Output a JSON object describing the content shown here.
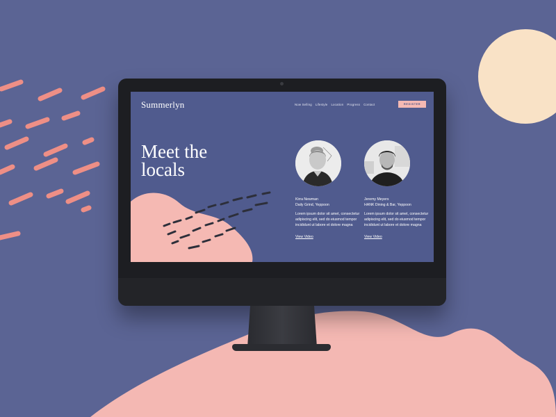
{
  "site": {
    "logo": "Summerlyn",
    "nav": [
      "Now Selling",
      "Lifestyle",
      "Location",
      "Progress",
      "Contact"
    ],
    "register_label": "REGISTER"
  },
  "hero": {
    "title_line1": "Meet the",
    "title_line2": "locals"
  },
  "profiles": [
    {
      "name": "Kirra Newman",
      "business": "Daily Grind,  Yeppoon",
      "desc": "Lorem ipsum dolor sit amet, consectetur adipiscing elit, sed do eiusmod tempor incididunt ut labore et dolore magna",
      "link": "View Video"
    },
    {
      "name": "Jeremy Meyers",
      "business": "HANK Dining & Bar, Yeppoon",
      "desc": "Lorem ipsum dolor sit amet, consectetur adipiscing elit, sed do eiusmod tempor incididunt ut labore et dolore magna",
      "link": "View Video"
    }
  ],
  "colors": {
    "background": "#5b6494",
    "screen": "#505b8e",
    "pink": "#f5b9b3",
    "sun": "#f9e2c6",
    "dash": "#ee8f86"
  }
}
